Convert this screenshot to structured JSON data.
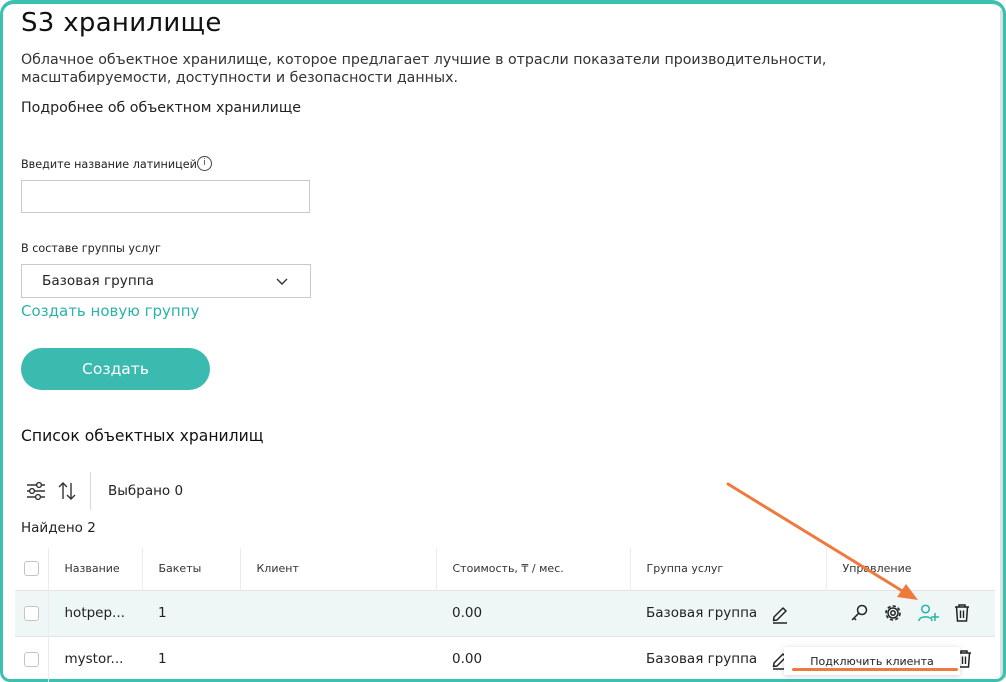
{
  "header": {
    "title": "S3 хранилище",
    "description": "Облачное объектное хранилище, которое предлагает лучшие в отрасли показатели производительности, масштабируемости, доступности и безопасности данных.",
    "more_link": "Подробнее об объектном хранилище"
  },
  "form": {
    "name_label": "Введите название латиницей",
    "name_value": "",
    "group_label": "В составе группы услуг",
    "group_selected": "Базовая группа",
    "create_group_link": "Создать новую группу",
    "create_button": "Создать"
  },
  "list": {
    "title": "Список объектных хранилищ",
    "selected_text": "Выбрано 0",
    "found_text": "Найдено 2",
    "columns": [
      "Название",
      "Бакеты",
      "Клиент",
      "Стоимость, ₸ / мес.",
      "Группа услуг",
      "Управление"
    ],
    "rows": [
      {
        "name": "hotpep...",
        "buckets": "1",
        "client": "",
        "cost": "0.00",
        "group": "Базовая группа"
      },
      {
        "name": "mystor...",
        "buckets": "1",
        "client": "",
        "cost": "0.00",
        "group": "Базовая группа"
      }
    ]
  },
  "tooltip": {
    "text": "Подключить клиента"
  },
  "icons": {
    "filter": "filter-sliders-icon",
    "sort": "sort-arrows-icon",
    "info": "info-icon",
    "edit": "pencil-icon",
    "key": "key-icon",
    "settings": "gear-icon",
    "add_user": "add-user-icon",
    "delete": "trash-icon"
  },
  "colors": {
    "accent": "#3bbbb0",
    "annotation": "#ef7a3d"
  }
}
